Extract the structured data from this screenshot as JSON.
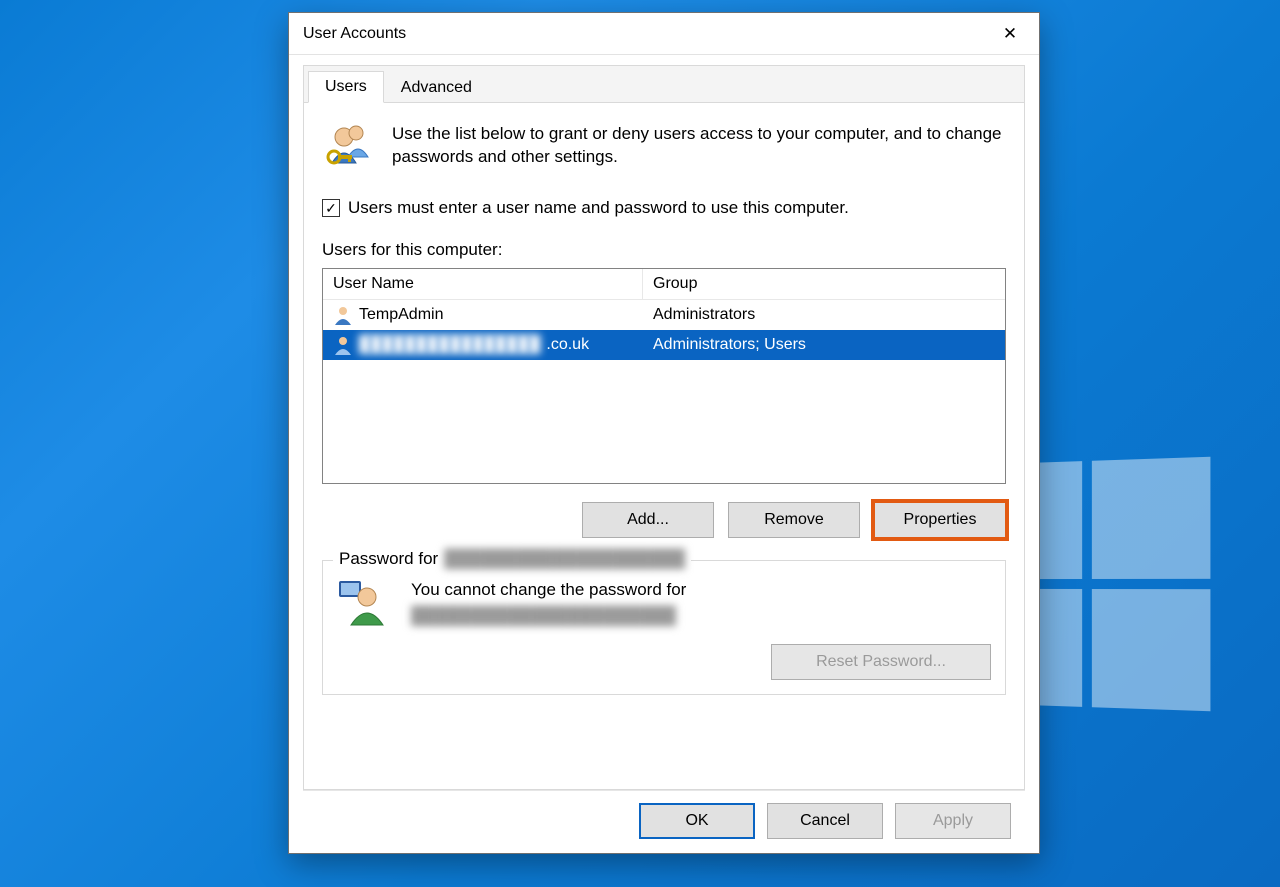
{
  "window": {
    "title": "User Accounts",
    "close_glyph": "✕"
  },
  "tabs": {
    "users": "Users",
    "advanced": "Advanced"
  },
  "intro": "Use the list below to grant or deny users access to your computer, and to change passwords and other settings.",
  "checkbox": {
    "checked_glyph": "✓",
    "label": "Users must enter a user name and password to use this computer."
  },
  "list_label": "Users for this computer:",
  "columns": {
    "user": "User Name",
    "group": "Group"
  },
  "rows": [
    {
      "user": "TempAdmin",
      "group": "Administrators",
      "selected": false,
      "redacted": false
    },
    {
      "user_redacted_prefix": "████████████████",
      "user_suffix": ".co.uk",
      "group": "Administrators; Users",
      "selected": true,
      "redacted": true
    }
  ],
  "buttons": {
    "add": "Add...",
    "remove": "Remove",
    "properties": "Properties"
  },
  "password_section": {
    "legend_prefix": "Password for ",
    "legend_redacted": "████████████████████",
    "line1": "You cannot change the password for",
    "line2_redacted": "██████████████████████",
    "reset": "Reset Password..."
  },
  "dialog_buttons": {
    "ok": "OK",
    "cancel": "Cancel",
    "apply": "Apply"
  }
}
